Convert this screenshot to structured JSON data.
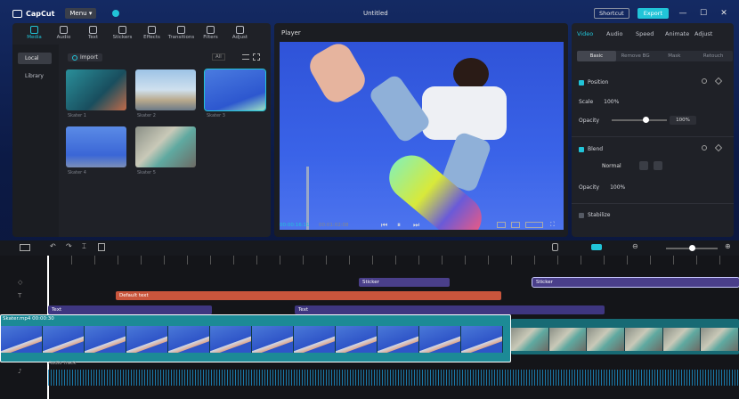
{
  "app": {
    "name": "CapCut",
    "menu_label": "Menu",
    "window_title": "Untitled",
    "shortcut_label": "Shortcut",
    "export_label": "Export",
    "minimize": "—",
    "maximize": "☐",
    "close": "✕"
  },
  "media_toolbar": [
    {
      "label": "Media",
      "icon": "media-icon",
      "active": true
    },
    {
      "label": "Audio",
      "icon": "audio-icon"
    },
    {
      "label": "Text",
      "icon": "text-icon"
    },
    {
      "label": "Stickers",
      "icon": "sticker-icon"
    },
    {
      "label": "Effects",
      "icon": "effects-icon"
    },
    {
      "label": "Transitions",
      "icon": "transitions-icon"
    },
    {
      "label": "Filters",
      "icon": "filters-icon"
    },
    {
      "label": "Adjust",
      "icon": "adjust-icon"
    }
  ],
  "media_sidebar": [
    {
      "label": "Local",
      "active": true
    },
    {
      "label": "Library"
    }
  ],
  "media": {
    "import_label": "Import",
    "sort_label": "All",
    "items": [
      {
        "label": "Skater 1"
      },
      {
        "label": "Skater 2"
      },
      {
        "label": "Skater 3"
      },
      {
        "label": "Skater 4"
      },
      {
        "label": "Skater 5"
      }
    ]
  },
  "monitor": {
    "title": "Player",
    "timecode_current": "00:00:16:11",
    "timecode_total": "00:01:02:08"
  },
  "inspector": {
    "tabs": [
      {
        "label": "Video",
        "active": true
      },
      {
        "label": "Audio"
      },
      {
        "label": "Speed"
      },
      {
        "label": "Animate"
      },
      {
        "label": "Adjust"
      }
    ],
    "subtabs": [
      {
        "label": "Basic",
        "active": true
      },
      {
        "label": "Remove BG"
      },
      {
        "label": "Mask"
      },
      {
        "label": "Retouch"
      }
    ],
    "position_label": "Position",
    "scale_label": "Scale",
    "scale_value": "100%",
    "opacity_label": "Opacity",
    "opacity_value": "100%",
    "blend_label": "Blend",
    "blend_mode": "Normal",
    "opacity2_label": "Opacity",
    "opacity2_value": "100%",
    "stabilize_label": "Stabilize"
  },
  "timeline": {
    "tracks": [
      {
        "label": "Sticker",
        "icon": "sticker-icon"
      },
      {
        "label": "Sticker",
        "icon": "sticker-icon"
      },
      {
        "label": "Default text"
      },
      {
        "label": "Text"
      },
      {
        "label": "Text"
      }
    ],
    "main_clip_label": "Skater.mp4  00:00:30",
    "audio_label": "Audio track"
  },
  "colors": {
    "accent": "#21c4d8",
    "panel": "#1f2127",
    "text_clip": "#c9553c",
    "sticker_clip": "#4a3f8a",
    "video_clip": "#1c8a96"
  }
}
